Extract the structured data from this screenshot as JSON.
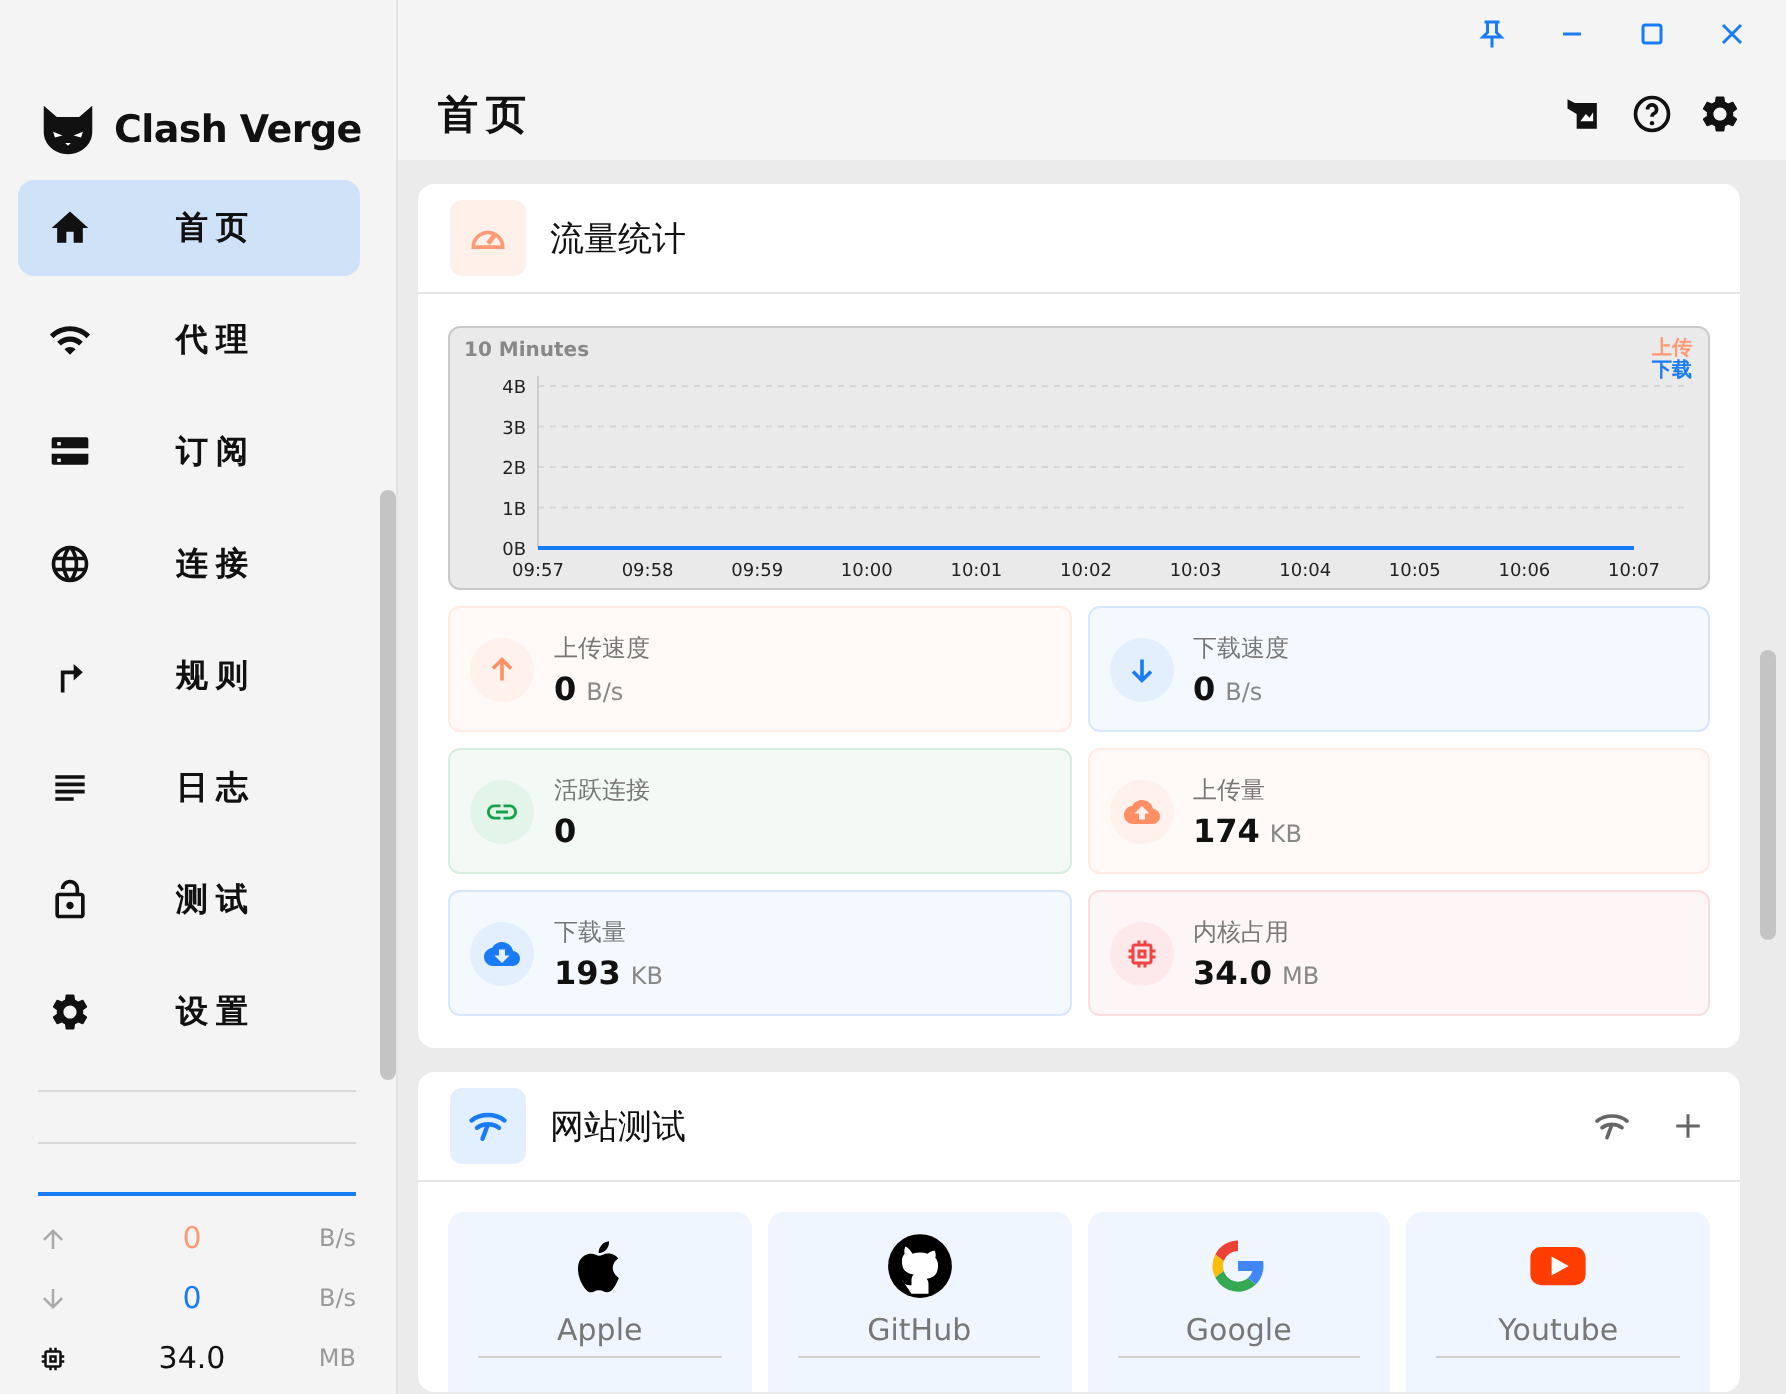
{
  "app": {
    "name": "Clash Verge"
  },
  "sidebar": {
    "items": [
      {
        "kind": "home",
        "label": "首页",
        "selected": true
      },
      {
        "kind": "wifi",
        "label": "代理",
        "selected": false
      },
      {
        "kind": "storage",
        "label": "订阅",
        "selected": false
      },
      {
        "kind": "globe",
        "label": "连接",
        "selected": false
      },
      {
        "kind": "rule",
        "label": "规则",
        "selected": false
      },
      {
        "kind": "logs",
        "label": "日志",
        "selected": false
      },
      {
        "kind": "lock",
        "label": "测试",
        "selected": false
      },
      {
        "kind": "settings",
        "label": "设置",
        "selected": false
      }
    ],
    "traffic": [
      {
        "kind": "up",
        "value": "0",
        "unit": "B/s"
      },
      {
        "kind": "down",
        "value": "0",
        "unit": "B/s"
      },
      {
        "kind": "memory",
        "value": "34.0",
        "unit": "MB"
      }
    ]
  },
  "page": {
    "title": "首页"
  },
  "traffic_card": {
    "title": "流量统计",
    "chart_data": {
      "type": "line",
      "title": "10 Minutes",
      "categories": [
        "09:57",
        "09:58",
        "09:59",
        "10:00",
        "10:01",
        "10:02",
        "10:03",
        "10:04",
        "10:05",
        "10:06",
        "10:07"
      ],
      "series": [
        {
          "name": "上传",
          "color": "#fe9a76",
          "values": [
            null,
            null,
            null,
            null,
            null,
            null,
            null,
            null,
            null,
            null,
            null
          ]
        },
        {
          "name": "下载",
          "color": "#1a7cf5",
          "values": [
            0,
            0,
            0,
            0,
            0,
            0,
            0,
            0,
            0,
            0,
            0
          ]
        }
      ],
      "ylim": [
        0,
        4
      ],
      "grid": true,
      "yticks": [
        {
          "value": 0,
          "label": "0B"
        },
        {
          "value": 1,
          "label": "1B"
        },
        {
          "value": 2,
          "label": "2B"
        },
        {
          "value": 3,
          "label": "3B"
        },
        {
          "value": 4,
          "label": "4B"
        }
      ]
    },
    "stats": [
      {
        "kind": "up",
        "label": "上传速度",
        "value": "0",
        "unit": "B/s",
        "color": "#fe8e64"
      },
      {
        "kind": "down",
        "label": "下载速度",
        "value": "0",
        "unit": "B/s",
        "color": "#1a7cf5"
      },
      {
        "kind": "link",
        "label": "活跃连接",
        "value": "0",
        "color": "#16a34a"
      },
      {
        "kind": "cloud-up",
        "label": "上传量",
        "value": "174",
        "unit": "KB",
        "color": "#fe8e64"
      },
      {
        "kind": "cloud-down",
        "label": "下载量",
        "value": "193",
        "unit": "KB",
        "color": "#1a7cf5"
      },
      {
        "kind": "chip",
        "label": "内核占用",
        "value": "34.0",
        "unit": "MB",
        "color": "#ef4444"
      }
    ]
  },
  "site_test": {
    "title": "网站测试",
    "sites": [
      {
        "kind": "apple",
        "name": "Apple"
      },
      {
        "kind": "github",
        "name": "GitHub"
      },
      {
        "kind": "google",
        "name": "Google"
      },
      {
        "kind": "youtube",
        "name": "Youtube"
      }
    ]
  }
}
